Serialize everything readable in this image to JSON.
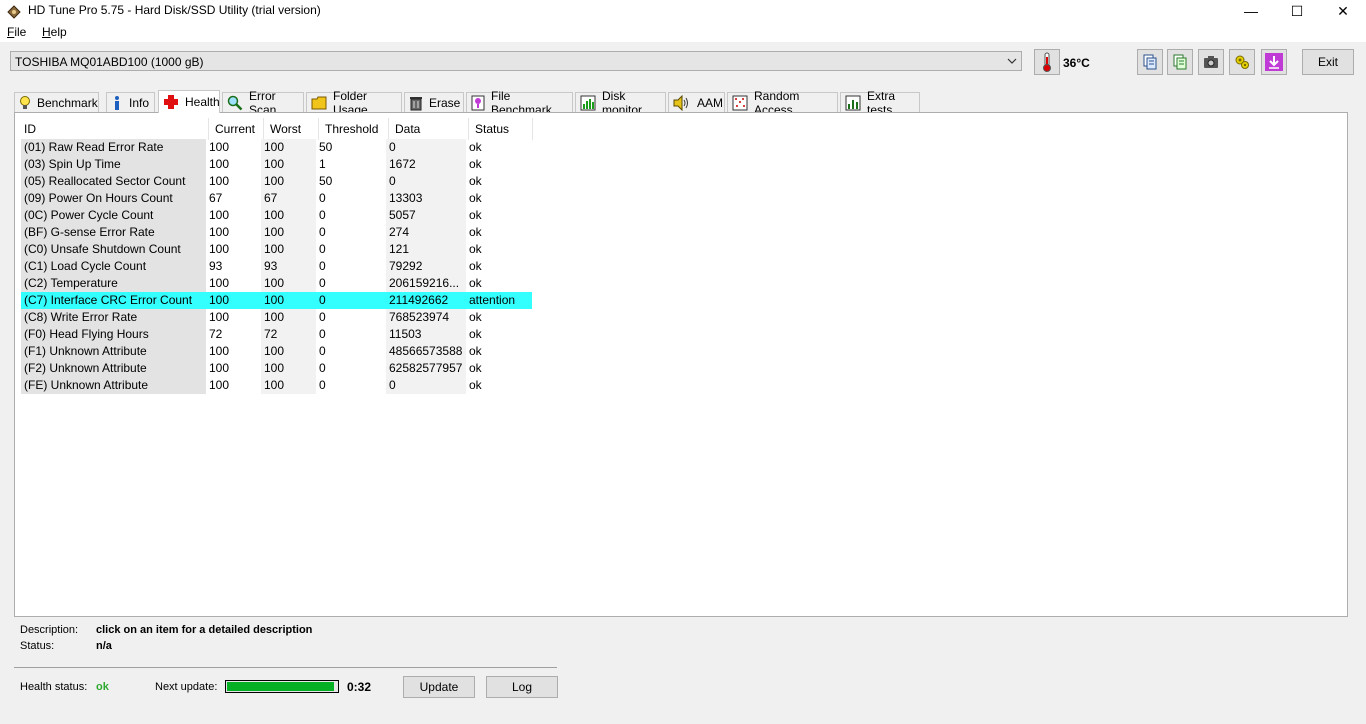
{
  "window": {
    "title": "HD Tune Pro 5.75 - Hard Disk/SSD Utility (trial version)",
    "controls": {
      "minimize": "—",
      "maximize": "☐",
      "close": "✕"
    }
  },
  "menu": {
    "file": {
      "accel": "F",
      "rest": "ile"
    },
    "help": {
      "accel": "H",
      "rest": "elp"
    }
  },
  "toolbar": {
    "drive": "TOSHIBA MQ01ABD100 (1000 gB)",
    "temperature": "36°C",
    "exit_label": "Exit"
  },
  "tabs": [
    {
      "label": "Benchmark",
      "icon": "lightbulb-icon"
    },
    {
      "label": "Info",
      "icon": "info-icon"
    },
    {
      "label": "Health",
      "icon": "red-cross-icon",
      "active": true
    },
    {
      "label": "Error Scan",
      "icon": "magnifier-icon"
    },
    {
      "label": "Folder Usage",
      "icon": "folder-icon"
    },
    {
      "label": "Erase",
      "icon": "trash-icon"
    },
    {
      "label": "File Benchmark",
      "icon": "file-benchmark-icon"
    },
    {
      "label": "Disk monitor",
      "icon": "disk-monitor-icon"
    },
    {
      "label": "AAM",
      "icon": "speaker-icon"
    },
    {
      "label": "Random Access",
      "icon": "random-access-icon"
    },
    {
      "label": "Extra tests",
      "icon": "extra-tests-icon"
    }
  ],
  "table": {
    "headers": [
      "ID",
      "Current",
      "Worst",
      "Threshold",
      "Data",
      "Status"
    ],
    "rows": [
      [
        "(01) Raw Read Error Rate",
        "100",
        "100",
        "50",
        "0",
        "ok"
      ],
      [
        "(03) Spin Up Time",
        "100",
        "100",
        "1",
        "1672",
        "ok"
      ],
      [
        "(05) Reallocated Sector Count",
        "100",
        "100",
        "50",
        "0",
        "ok"
      ],
      [
        "(09) Power On Hours Count",
        "67",
        "67",
        "0",
        "13303",
        "ok"
      ],
      [
        "(0C) Power Cycle Count",
        "100",
        "100",
        "0",
        "5057",
        "ok"
      ],
      [
        "(BF) G-sense Error Rate",
        "100",
        "100",
        "0",
        "274",
        "ok"
      ],
      [
        "(C0) Unsafe Shutdown Count",
        "100",
        "100",
        "0",
        "121",
        "ok"
      ],
      [
        "(C1) Load Cycle Count",
        "93",
        "93",
        "0",
        "79292",
        "ok"
      ],
      [
        "(C2) Temperature",
        "100",
        "100",
        "0",
        "206159216...",
        "ok"
      ],
      [
        "(C7) Interface CRC Error Count",
        "100",
        "100",
        "0",
        "211492662",
        "attention"
      ],
      [
        "(C8) Write Error Rate",
        "100",
        "100",
        "0",
        "768523974",
        "ok"
      ],
      [
        "(F0) Head Flying Hours",
        "72",
        "72",
        "0",
        "11503",
        "ok"
      ],
      [
        "(F1) Unknown Attribute",
        "100",
        "100",
        "0",
        "48566573588",
        "ok"
      ],
      [
        "(F2) Unknown Attribute",
        "100",
        "100",
        "0",
        "62582577957",
        "ok"
      ],
      [
        "(FE) Unknown Attribute",
        "100",
        "100",
        "0",
        "0",
        "ok"
      ]
    ],
    "highlight_row": 9,
    "highlight_color": "#33ffff"
  },
  "details": {
    "description_label": "Description:",
    "description_value": "click on an item for a detailed description",
    "status_label": "Status:",
    "status_value": "n/a"
  },
  "footer": {
    "health_label": "Health status:",
    "health_value": "ok",
    "next_update_label": "Next update:",
    "progress_fraction": 0.97,
    "time_left": "0:32",
    "update_label": "Update",
    "log_label": "Log"
  },
  "colors": {
    "progress": "#06b025",
    "health_ok": "#2fa82f",
    "id_column_bg": "#e3e3e3"
  }
}
